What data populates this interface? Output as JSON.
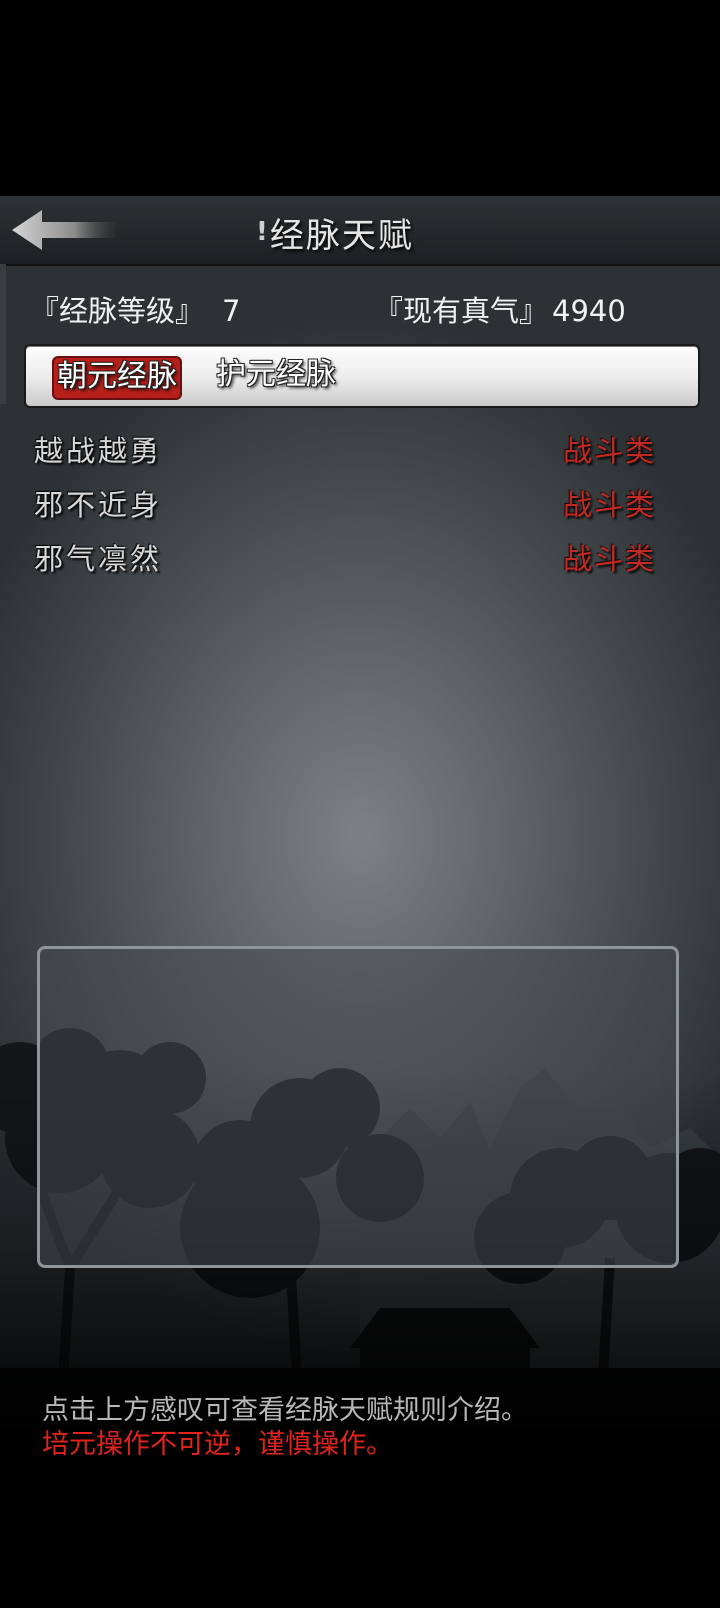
{
  "header": {
    "title": "经脉天赋",
    "info_icon": "!"
  },
  "stats": {
    "level_label": "『经脉等级』",
    "level_value": "7",
    "qi_label": "『现有真气』",
    "qi_value": "4940"
  },
  "tabs": [
    {
      "label": "朝元经脉",
      "active": true
    },
    {
      "label": "护元经脉",
      "active": false
    }
  ],
  "talents": [
    {
      "name": "越战越勇",
      "type": "战斗类"
    },
    {
      "name": "邪不近身",
      "type": "战斗类"
    },
    {
      "name": "邪气凛然",
      "type": "战斗类"
    }
  ],
  "footer": {
    "note_info": "点击上方感叹可查看经脉天赋规则介绍。",
    "note_warning": "培元操作不可逆，谨慎操作。"
  },
  "colors": {
    "accent_red": "#b61f1a",
    "warning_red": "#e0241c",
    "type_red": "#c02a22"
  }
}
